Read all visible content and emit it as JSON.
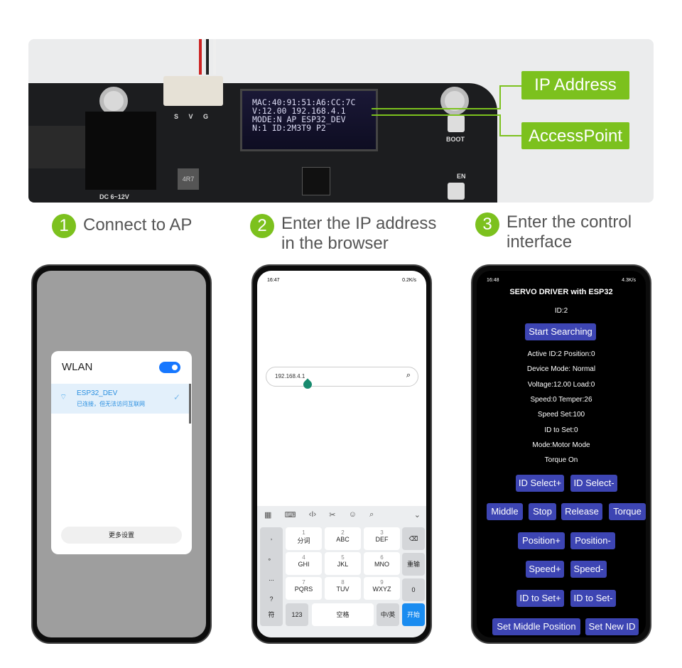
{
  "board": {
    "oled_lines": [
      "MAC:40:91:51:A6:CC:7C",
      "V:12.00 192.168.4.1",
      "MODE:N AP ESP32_DEV",
      "N:1 ID:2M3T9 P2"
    ],
    "silk": {
      "connector": "S V G",
      "boot": "BOOT",
      "en": "EN",
      "power": "DC 6~12V",
      "inductor": "4R7"
    }
  },
  "callouts": {
    "ip": "IP Address",
    "ap": "AccessPoint"
  },
  "steps": [
    {
      "num": "1",
      "text": "Connect to AP"
    },
    {
      "num": "2",
      "text": "Enter the IP address in the browser"
    },
    {
      "num": "3",
      "text": "Enter the control interface"
    }
  ],
  "phone1": {
    "title": "WLAN",
    "wifi_on": true,
    "network": "ESP32_DEV",
    "status": "已连接，但无法访问互联网",
    "more": "更多设置"
  },
  "phone2": {
    "time": "16:47",
    "speed": "0.2K/s",
    "url": "192.168.4.1",
    "keys": [
      {
        "n": "1",
        "l": "分词"
      },
      {
        "n": "2",
        "l": "ABC"
      },
      {
        "n": "3",
        "l": "DEF"
      },
      {
        "n": "4",
        "l": "GHI"
      },
      {
        "n": "5",
        "l": "JKL"
      },
      {
        "n": "6",
        "l": "MNO"
      },
      {
        "n": "7",
        "l": "PQRS"
      },
      {
        "n": "8",
        "l": "TUV"
      },
      {
        "n": "9",
        "l": "WXYZ"
      }
    ],
    "side": [
      ",",
      "。",
      "...",
      "?"
    ],
    "right": [
      "⌫",
      "重输",
      "0"
    ],
    "bottom": {
      "sym": "符",
      "num": "123",
      "space": "空格",
      "lang": "中/英",
      "go": "开始"
    }
  },
  "phone3": {
    "time": "16:48",
    "speed": "4.3K/s",
    "title": "SERVO DRIVER with ESP32",
    "id": "ID:2",
    "search": "Start Searching",
    "info": [
      "Active ID:2 Position:0",
      "Device Mode: Normal",
      "Voltage:12.00 Load:0",
      "Speed:0 Temper:26",
      "Speed Set:100",
      "ID to Set:0",
      "Mode:Motor Mode",
      "Torque On"
    ],
    "buttons": [
      "ID Select+",
      "ID Select-",
      "Middle",
      "Stop",
      "Release",
      "Torque",
      "Position+",
      "Position-",
      "Speed+",
      "Speed-",
      "ID to Set+",
      "ID to Set-",
      "Set Middle Position",
      "Set New ID"
    ]
  },
  "colors": {
    "accent": "#7cc11e",
    "button": "#3d45b3",
    "toggle": "#1677ff"
  }
}
